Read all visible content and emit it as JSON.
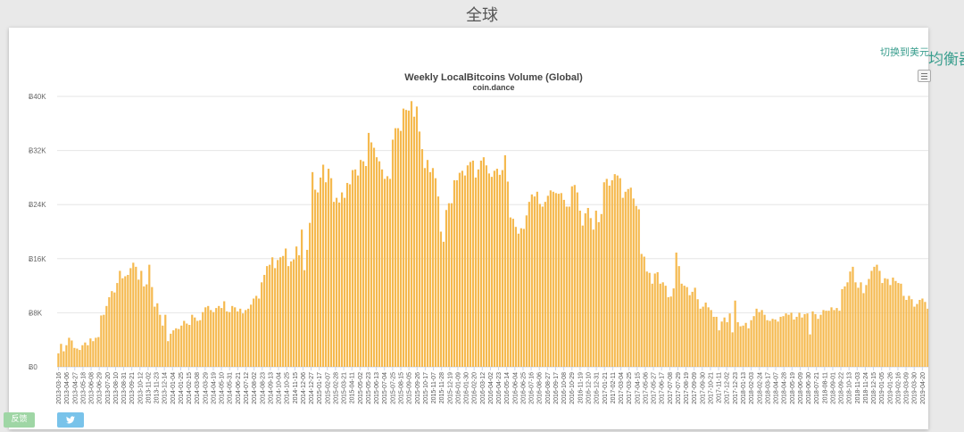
{
  "page": {
    "heading": "全球",
    "switch_link": "切换到美元",
    "balance_label": "均衡器",
    "feedback_label": "反馈"
  },
  "icons": {
    "menu": "hamburger-menu-icon",
    "twitter": "twitter-bird-icon"
  },
  "colors": {
    "bar": "#f5b94e",
    "title": "#444444",
    "link": "#3a9e8e"
  },
  "chart_data": {
    "type": "bar",
    "title": "Weekly LocalBitcoins Volume (Global)",
    "subtitle": "coin.dance",
    "xlabel": "",
    "ylabel": "",
    "ylim": [
      0,
      40000
    ],
    "yticks": [
      0,
      8000,
      16000,
      24000,
      32000,
      40000
    ],
    "ytick_labels": [
      "Ƀ0",
      "Ƀ8K",
      "Ƀ16K",
      "Ƀ24K",
      "Ƀ32K",
      "Ƀ40K"
    ],
    "grid": true,
    "legend": "none",
    "x_start": "2013-03-16",
    "x_end": "2019-05-11",
    "x_tick_labels": [
      "2013-03-16",
      "2013-04-06",
      "2013-04-27",
      "2013-05-18",
      "2013-06-08",
      "2013-06-29",
      "2013-07-20",
      "2013-08-10",
      "2013-08-31",
      "2013-09-21",
      "2013-10-12",
      "2013-11-02",
      "2013-11-23",
      "2013-12-14",
      "2014-01-04",
      "2014-01-25",
      "2014-02-15",
      "2014-03-08",
      "2014-03-29",
      "2014-04-19",
      "2014-05-10",
      "2014-05-31",
      "2014-06-21",
      "2014-07-12",
      "2014-08-02",
      "2014-08-23",
      "2014-09-13",
      "2014-10-04",
      "2014-10-25",
      "2014-11-15",
      "2014-12-06",
      "2014-12-27",
      "2015-01-17",
      "2015-02-07",
      "2015-02-28",
      "2015-03-21",
      "2015-04-11",
      "2015-05-02",
      "2015-05-23",
      "2015-06-13",
      "2015-07-04",
      "2015-07-25",
      "2015-08-15",
      "2015-09-05",
      "2015-09-26",
      "2015-10-17",
      "2015-11-07",
      "2015-11-28",
      "2015-12-19",
      "2016-01-09",
      "2016-01-30",
      "2016-02-20",
      "2016-03-12",
      "2016-04-02",
      "2016-04-23",
      "2016-05-14",
      "2016-06-04",
      "2016-06-25",
      "2016-07-16",
      "2016-08-06",
      "2016-08-27",
      "2016-09-17",
      "2016-10-08",
      "2016-10-29",
      "2016-11-19",
      "2016-12-10",
      "2016-12-31",
      "2017-01-21",
      "2017-02-11",
      "2017-03-04",
      "2017-03-25",
      "2017-04-15",
      "2017-05-06",
      "2017-05-27",
      "2017-06-17",
      "2017-07-08",
      "2017-07-29",
      "2017-08-19",
      "2017-09-09",
      "2017-09-30",
      "2017-10-21",
      "2017-11-11",
      "2017-12-02",
      "2017-12-23",
      "2018-01-13",
      "2018-02-03",
      "2018-02-24",
      "2018-03-17",
      "2018-04-07",
      "2018-04-28",
      "2018-05-19",
      "2018-06-09",
      "2018-06-30",
      "2018-07-21",
      "2018-08-11",
      "2018-09-01",
      "2018-09-22",
      "2018-10-13",
      "2018-11-03",
      "2018-11-24",
      "2018-12-15",
      "2019-01-05",
      "2019-01-26",
      "2019-02-16",
      "2019-03-09",
      "2019-03-30",
      "2019-04-20",
      "2019-05-11"
    ],
    "weekly_values": [
      2000,
      3400,
      2300,
      3200,
      4300,
      3900,
      2800,
      2700,
      2500,
      3200,
      3600,
      3200,
      4200,
      3800,
      4300,
      4400,
      7600,
      7700,
      9000,
      10300,
      11200,
      11000,
      12400,
      14200,
      13100,
      13400,
      13600,
      14600,
      15400,
      14800,
      12900,
      14200,
      11900,
      12200,
      15100,
      11800,
      8900,
      9400,
      7700,
      6100,
      7700,
      3800,
      4900,
      5400,
      5700,
      5600,
      6100,
      6800,
      6400,
      6200,
      7700,
      7300,
      6800,
      6900,
      8100,
      8800,
      9000,
      8400,
      8100,
      8700,
      9000,
      8700,
      9700,
      8200,
      8100,
      9000,
      8800,
      8200,
      8600,
      7900,
      8400,
      8600,
      9200,
      10100,
      10500,
      10100,
      12500,
      13600,
      14900,
      15100,
      16200,
      14600,
      15800,
      16200,
      16400,
      17500,
      14900,
      15600,
      15900,
      17800,
      16500,
      20300,
      14300,
      17300,
      21300,
      28800,
      26200,
      25800,
      28000,
      29900,
      27300,
      29300,
      27900,
      24400,
      25000,
      24300,
      25800,
      25000,
      27200,
      27000,
      29100,
      29200,
      28300,
      30600,
      30400,
      29700,
      34600,
      33200,
      32400,
      31000,
      30400,
      29200,
      27800,
      28200,
      27800,
      33600,
      35300,
      35300,
      34900,
      38200,
      38000,
      37900,
      39300,
      37000,
      38500,
      34800,
      32200,
      29400,
      30600,
      28800,
      29400,
      27900,
      25200,
      20000,
      18500,
      23200,
      24200,
      24200,
      27600,
      27600,
      28700,
      29000,
      28300,
      29800,
      30300,
      30500,
      28000,
      29200,
      30500,
      31000,
      29800,
      28600,
      28100,
      29000,
      29300,
      28400,
      29100,
      31300,
      27400,
      22100,
      21900,
      20700,
      19700,
      20500,
      20400,
      22400,
      24400,
      25500,
      25200,
      25900,
      24100,
      23700,
      24400,
      25300,
      26100,
      25900,
      25700,
      25600,
      25700,
      24700,
      23700,
      23700,
      26700,
      26900,
      25800,
      23100,
      20900,
      22700,
      23500,
      22000,
      20300,
      23100,
      21400,
      22600,
      27300,
      27800,
      26800,
      27600,
      28500,
      28300,
      27900,
      25000,
      25900,
      26300,
      26500,
      24900,
      23800,
      23300,
      16700,
      16300,
      14100,
      13900,
      12300,
      13800,
      14000,
      12300,
      12500,
      12000,
      10300,
      10400,
      11600,
      16900,
      14900,
      12300,
      12000,
      11800,
      10600,
      11100,
      11700,
      10000,
      8600,
      8900,
      9500,
      8800,
      8400,
      7400,
      7400,
      5400,
      6700,
      7300,
      6600,
      7900,
      5100,
      9800,
      6600,
      6000,
      6100,
      6500,
      5700,
      6900,
      7500,
      8600,
      8100,
      8400,
      7700,
      6900,
      6800,
      7100,
      7000,
      6700,
      7400,
      7500,
      7900,
      7700,
      8000,
      7000,
      7400,
      8000,
      7300,
      7800,
      7900,
      4800,
      8200,
      7800,
      7100,
      7700,
      8400,
      8300,
      8300,
      8800,
      8400,
      8700,
      8300,
      11500,
      11900,
      12500,
      14100,
      14800,
      12500,
      11700,
      12500,
      10900,
      12100,
      13000,
      14200,
      14800,
      15100,
      14200,
      12400,
      13100,
      13000,
      12100,
      13200,
      12700,
      12400,
      12300,
      10500,
      9900,
      10500,
      10000,
      8900,
      9300,
      9900,
      10100,
      9600,
      8600,
      8400
    ]
  }
}
